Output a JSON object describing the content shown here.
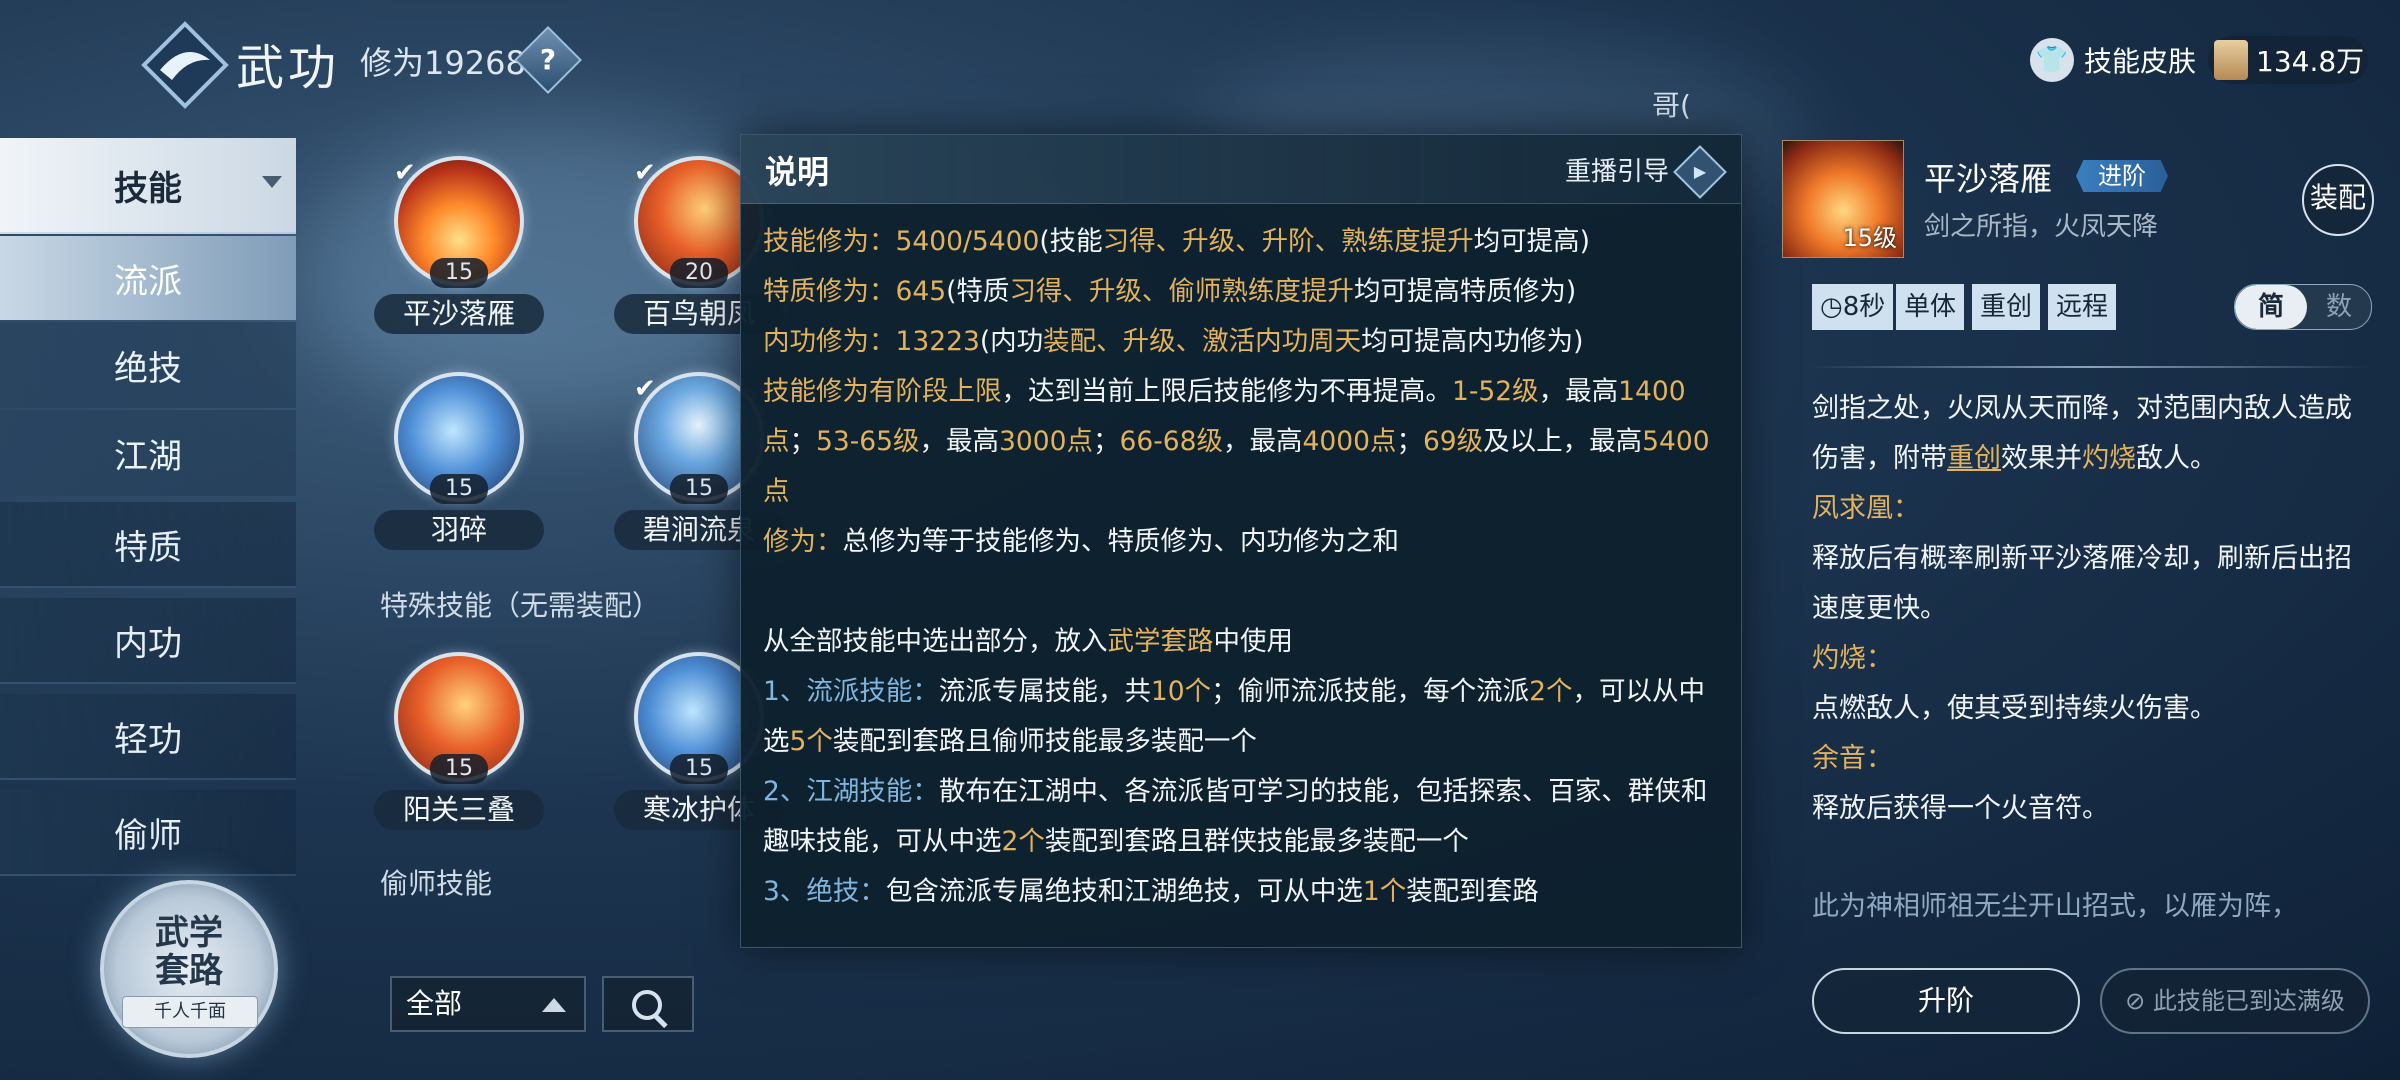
{
  "header": {
    "title": "武功",
    "cultivation_label": "修为19268",
    "help": "?",
    "skin_label": "技能皮肤",
    "currency": "134.8万",
    "corner_text": "哥("
  },
  "nav": {
    "items": [
      "技能",
      "流派",
      "绝技",
      "江湖",
      "特质",
      "内功",
      "轻功",
      "偷师"
    ],
    "route_title": "武学\n套路",
    "route_tag": "千人千面"
  },
  "skills": [
    {
      "name": "平沙落雁",
      "level": "15"
    },
    {
      "name": "百鸟朝凤",
      "level": "20"
    },
    {
      "name": "羽碎",
      "level": "15"
    },
    {
      "name": "碧涧流泉",
      "level": "15"
    },
    {
      "name": "阳关三叠",
      "level": "15"
    },
    {
      "name": "寒冰护体",
      "level": "15"
    }
  ],
  "sections": {
    "special": "特殊技能（无需装配）",
    "steal": "偷师技能"
  },
  "filter": {
    "selected": "全部"
  },
  "modal": {
    "title": "说明",
    "replay": "重播引导"
  },
  "detail": {
    "name": "平沙落雁",
    "advance": "进阶",
    "subtitle": "剑之所指，火凤天降",
    "level": "15级",
    "equip": "装配",
    "tags": [
      "8秒",
      "单体",
      "重创",
      "远程"
    ],
    "toggle_on": "简",
    "toggle_off": "数",
    "lore": "此为神相师祖无尘开山招式，以雁为阵，",
    "upgrade": "升阶",
    "maxed": "此技能已到达满级"
  }
}
